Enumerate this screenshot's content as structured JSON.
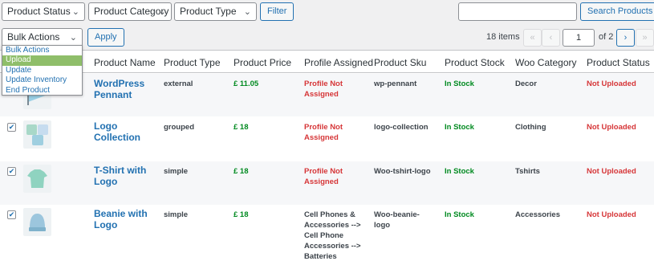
{
  "filters": {
    "product_status": "Product Status",
    "product_category": "Product Category",
    "product_type": "Product Type",
    "filter_button": "Filter"
  },
  "search": {
    "value": "",
    "button": "Search Products"
  },
  "bulk": {
    "selected": "Bulk Actions",
    "apply": "Apply",
    "options": [
      "Bulk Actions",
      "Upload",
      "Update",
      "Update Inventory",
      "End Product"
    ],
    "highlighted": "Upload"
  },
  "pagination": {
    "items": "18 items",
    "first": "«",
    "prev": "‹",
    "current": "1",
    "of": "of 2",
    "next": "›",
    "last": "»"
  },
  "columns": [
    "Product Name",
    "Product Type",
    "Product Price",
    "Profile Assigned",
    "Product Sku",
    "Product Stock",
    "Woo Category",
    "Product Status"
  ],
  "rows": [
    {
      "name": "WordPress Pennant",
      "type": "external",
      "price": "£ 11.05",
      "profile": "Profile Not Assigned",
      "sku": "wp-pennant",
      "stock": "In Stock",
      "category": "Decor",
      "status": "Not Uploaded",
      "checked": false,
      "thumb": "pennant"
    },
    {
      "name": "Logo Collection",
      "type": "grouped",
      "price": "£ 18",
      "profile": "Profile Not Assigned",
      "sku": "logo-collection",
      "stock": "In Stock",
      "category": "Clothing",
      "status": "Not Uploaded",
      "checked": true,
      "thumb": "collection"
    },
    {
      "name": "T-Shirt with Logo",
      "type": "simple",
      "price": "£ 18",
      "profile": "Profile Not Assigned",
      "sku": "Woo-tshirt-logo",
      "stock": "In Stock",
      "category": "Tshirts",
      "status": "Not Uploaded",
      "checked": true,
      "thumb": "tshirt"
    },
    {
      "name": "Beanie with Logo",
      "type": "simple",
      "price": "£ 18",
      "profile": "Cell Phones & Accessories --> Cell Phone Accessories --> Batteries",
      "sku": "Woo-beanie-logo",
      "stock": "In Stock",
      "category": "Accessories",
      "status": "Not Uploaded",
      "checked": true,
      "thumb": "beanie"
    }
  ],
  "colors": {
    "link": "#2271b1",
    "error": "#d63638",
    "success": "#008a20",
    "highlight": "#8fbe6a"
  },
  "icons": [
    "chevron-down-icon",
    "checkbox-checked-icon"
  ]
}
